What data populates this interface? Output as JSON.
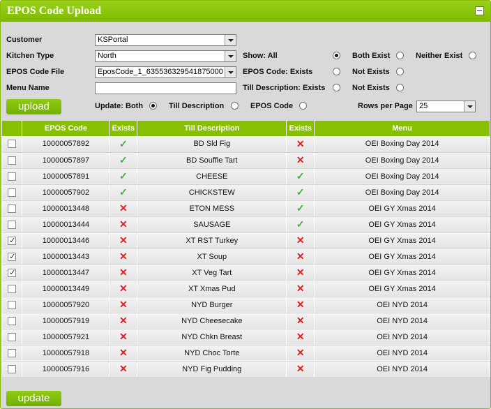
{
  "title": "EPOS Code Upload",
  "form": {
    "customer_label": "Customer",
    "customer_value": "KSPortal",
    "kitchen_label": "Kitchen Type",
    "kitchen_value": "North",
    "epos_file_label": "EPOS Code File",
    "epos_file_value": "EposCode_1_635536329541875000",
    "menu_name_label": "Menu Name",
    "menu_name_value": "",
    "upload_label": "upload",
    "show_label": "Show: All",
    "both_exist_label": "Both Exist",
    "neither_exist_label": "Neither Exist",
    "epos_exists_label": "EPOS Code: Exists",
    "epos_not_exists_label": "Not Exists",
    "till_exists_label": "Till Description: Exists",
    "till_not_exists_label": "Not Exists",
    "update_both_label": "Update: Both",
    "update_till_label": "Till Description",
    "update_epos_label": "EPOS Code",
    "rows_per_page_label": "Rows per Page",
    "rows_per_page_value": "25",
    "selected": {
      "show": "all",
      "update": "both"
    }
  },
  "table": {
    "headers": [
      "",
      "EPOS Code",
      "Exists",
      "Till Description",
      "Exists",
      "Menu"
    ],
    "rows": [
      {
        "checked": false,
        "code": "10000057892",
        "code_exists": true,
        "desc": "BD Sld Fig",
        "desc_exists": false,
        "menu": "OEI Boxing Day 2014"
      },
      {
        "checked": false,
        "code": "10000057897",
        "code_exists": true,
        "desc": "BD Souffle Tart",
        "desc_exists": false,
        "menu": "OEI Boxing Day 2014"
      },
      {
        "checked": false,
        "code": "10000057891",
        "code_exists": true,
        "desc": "CHEESE",
        "desc_exists": true,
        "menu": "OEI Boxing Day 2014"
      },
      {
        "checked": false,
        "code": "10000057902",
        "code_exists": true,
        "desc": "CHICKSTEW",
        "desc_exists": true,
        "menu": "OEI Boxing Day 2014"
      },
      {
        "checked": false,
        "code": "10000013448",
        "code_exists": false,
        "desc": "ETON MESS",
        "desc_exists": true,
        "menu": "OEI GY Xmas 2014"
      },
      {
        "checked": false,
        "code": "10000013444",
        "code_exists": false,
        "desc": "SAUSAGE",
        "desc_exists": true,
        "menu": "OEI GY Xmas 2014"
      },
      {
        "checked": true,
        "code": "10000013446",
        "code_exists": false,
        "desc": "XT RST Turkey",
        "desc_exists": false,
        "menu": "OEI GY Xmas 2014"
      },
      {
        "checked": true,
        "code": "10000013443",
        "code_exists": false,
        "desc": "XT Soup",
        "desc_exists": false,
        "menu": "OEI GY Xmas 2014"
      },
      {
        "checked": true,
        "code": "10000013447",
        "code_exists": false,
        "desc": "XT Veg Tart",
        "desc_exists": false,
        "menu": "OEI GY Xmas 2014"
      },
      {
        "checked": false,
        "code": "10000013449",
        "code_exists": false,
        "desc": "XT Xmas Pud",
        "desc_exists": false,
        "menu": "OEI GY Xmas 2014"
      },
      {
        "checked": false,
        "code": "10000057920",
        "code_exists": false,
        "desc": "NYD Burger",
        "desc_exists": false,
        "menu": "OEI NYD 2014"
      },
      {
        "checked": false,
        "code": "10000057919",
        "code_exists": false,
        "desc": "NYD Cheesecake",
        "desc_exists": false,
        "menu": "OEI NYD 2014"
      },
      {
        "checked": false,
        "code": "10000057921",
        "code_exists": false,
        "desc": "NYD Chkn Breast",
        "desc_exists": false,
        "menu": "OEI NYD 2014"
      },
      {
        "checked": false,
        "code": "10000057918",
        "code_exists": false,
        "desc": "NYD Choc Torte",
        "desc_exists": false,
        "menu": "OEI NYD 2014"
      },
      {
        "checked": false,
        "code": "10000057916",
        "code_exists": false,
        "desc": "NYD Fig Pudding",
        "desc_exists": false,
        "menu": "OEI NYD 2014"
      }
    ]
  },
  "update_label": "update",
  "icons": {
    "exists": "check-icon",
    "missing": "cross-icon"
  },
  "colors": {
    "accent": "#86c000",
    "check": "#3fae3f",
    "cross": "#e02020"
  }
}
